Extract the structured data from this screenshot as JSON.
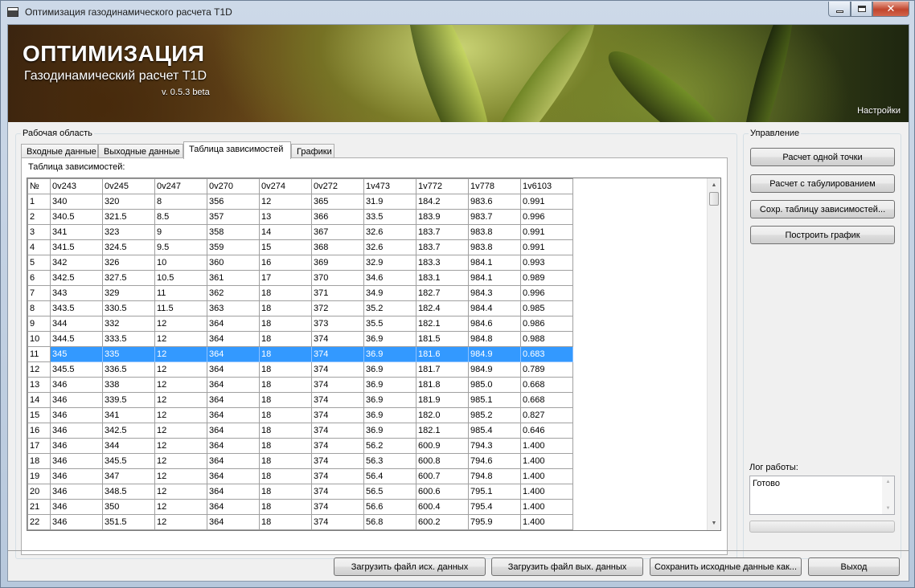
{
  "window": {
    "title": "Оптимизация газодинамического расчета T1D"
  },
  "banner": {
    "title": "ОПТИМИЗАЦИЯ",
    "subtitle": "Газодинамический расчет T1D",
    "version": "v. 0.5.3 beta",
    "settings": "Настройки"
  },
  "workarea": {
    "label": "Рабочая область",
    "tabs": [
      {
        "label": "Входные данные"
      },
      {
        "label": "Выходные данные"
      },
      {
        "label": "Таблица зависимостей"
      },
      {
        "label": "Графики"
      }
    ],
    "active_tab": "Таблица зависимостей",
    "panel_label": "Таблица зависимостей:",
    "table": {
      "columns": [
        "№",
        "0v243",
        "0v245",
        "0v247",
        "0v270",
        "0v274",
        "0v272",
        "1v473",
        "1v772",
        "1v778",
        "1v6103"
      ],
      "selected_row": "11",
      "rows": [
        [
          "1",
          "340",
          "320",
          "8",
          "356",
          "12",
          "365",
          "31.9",
          "184.2",
          "983.6",
          "0.991"
        ],
        [
          "2",
          "340.5",
          "321.5",
          "8.5",
          "357",
          "13",
          "366",
          "33.5",
          "183.9",
          "983.7",
          "0.996"
        ],
        [
          "3",
          "341",
          "323",
          "9",
          "358",
          "14",
          "367",
          "32.6",
          "183.7",
          "983.8",
          "0.991"
        ],
        [
          "4",
          "341.5",
          "324.5",
          "9.5",
          "359",
          "15",
          "368",
          "32.6",
          "183.7",
          "983.8",
          "0.991"
        ],
        [
          "5",
          "342",
          "326",
          "10",
          "360",
          "16",
          "369",
          "32.9",
          "183.3",
          "984.1",
          "0.993"
        ],
        [
          "6",
          "342.5",
          "327.5",
          "10.5",
          "361",
          "17",
          "370",
          "34.6",
          "183.1",
          "984.1",
          "0.989"
        ],
        [
          "7",
          "343",
          "329",
          "11",
          "362",
          "18",
          "371",
          "34.9",
          "182.7",
          "984.3",
          "0.996"
        ],
        [
          "8",
          "343.5",
          "330.5",
          "11.5",
          "363",
          "18",
          "372",
          "35.2",
          "182.4",
          "984.4",
          "0.985"
        ],
        [
          "9",
          "344",
          "332",
          "12",
          "364",
          "18",
          "373",
          "35.5",
          "182.1",
          "984.6",
          "0.986"
        ],
        [
          "10",
          "344.5",
          "333.5",
          "12",
          "364",
          "18",
          "374",
          "36.9",
          "181.5",
          "984.8",
          "0.988"
        ],
        [
          "11",
          "345",
          "335",
          "12",
          "364",
          "18",
          "374",
          "36.9",
          "181.6",
          "984.9",
          "0.683"
        ],
        [
          "12",
          "345.5",
          "336.5",
          "12",
          "364",
          "18",
          "374",
          "36.9",
          "181.7",
          "984.9",
          "0.789"
        ],
        [
          "13",
          "346",
          "338",
          "12",
          "364",
          "18",
          "374",
          "36.9",
          "181.8",
          "985.0",
          "0.668"
        ],
        [
          "14",
          "346",
          "339.5",
          "12",
          "364",
          "18",
          "374",
          "36.9",
          "181.9",
          "985.1",
          "0.668"
        ],
        [
          "15",
          "346",
          "341",
          "12",
          "364",
          "18",
          "374",
          "36.9",
          "182.0",
          "985.2",
          "0.827"
        ],
        [
          "16",
          "346",
          "342.5",
          "12",
          "364",
          "18",
          "374",
          "36.9",
          "182.1",
          "985.4",
          "0.646"
        ],
        [
          "17",
          "346",
          "344",
          "12",
          "364",
          "18",
          "374",
          "56.2",
          "600.9",
          "794.3",
          "1.400"
        ],
        [
          "18",
          "346",
          "345.5",
          "12",
          "364",
          "18",
          "374",
          "56.3",
          "600.8",
          "794.6",
          "1.400"
        ],
        [
          "19",
          "346",
          "347",
          "12",
          "364",
          "18",
          "374",
          "56.4",
          "600.7",
          "794.8",
          "1.400"
        ],
        [
          "20",
          "346",
          "348.5",
          "12",
          "364",
          "18",
          "374",
          "56.5",
          "600.6",
          "795.1",
          "1.400"
        ],
        [
          "21",
          "346",
          "350",
          "12",
          "364",
          "18",
          "374",
          "56.6",
          "600.4",
          "795.4",
          "1.400"
        ],
        [
          "22",
          "346",
          "351.5",
          "12",
          "364",
          "18",
          "374",
          "56.8",
          "600.2",
          "795.9",
          "1.400"
        ]
      ]
    }
  },
  "control": {
    "label": "Управление",
    "buttons": {
      "calc_single": "Расчет одной точки",
      "calc_tab": "Расчет с табулированием",
      "save_table": "Сохр. таблицу зависимостей...",
      "plot": "Построить график"
    },
    "log_label": "Лог работы:",
    "log_text": "Готово"
  },
  "footer": {
    "load_input": "Загрузить файл исх. данных",
    "load_output": "Загрузить файл вых. данных",
    "save_input": "Сохранить исходные данные как...",
    "exit": "Выход"
  },
  "colors": {
    "selection": "#3399ff",
    "window_frame": "#cdd9e8",
    "close_button": "#c1452d"
  }
}
